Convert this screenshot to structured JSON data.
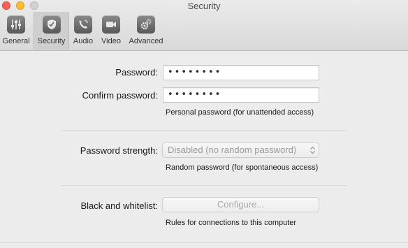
{
  "window": {
    "title": "Security",
    "traffic_lights": [
      "close",
      "minimize",
      "zoom"
    ]
  },
  "toolbar": {
    "items": [
      {
        "label": "General",
        "icon": "sliders-icon",
        "selected": false
      },
      {
        "label": "Security",
        "icon": "shield-icon",
        "selected": true
      },
      {
        "label": "Audio",
        "icon": "phone-icon",
        "selected": false
      },
      {
        "label": "Video",
        "icon": "video-camera-icon",
        "selected": false
      },
      {
        "label": "Advanced",
        "icon": "gears-icon",
        "selected": false
      }
    ]
  },
  "password_section": {
    "password_label": "Password:",
    "password_value": "••••••••",
    "confirm_label": "Confirm password:",
    "confirm_value": "••••••••",
    "hint": "Personal password (for unattended access)"
  },
  "strength_section": {
    "label": "Password strength:",
    "selected_option": "Disabled (no random password)",
    "hint": "Random password (for spontaneous access)"
  },
  "whitelist_section": {
    "label": "Black and whitelist:",
    "button_label": "Configure...",
    "hint": "Rules for connections to this computer"
  },
  "colors": {
    "window_bg": "#ececec",
    "close": "#fc5f57",
    "minimize": "#fdbc2e",
    "zoom_inactive": "#d0d0d0"
  }
}
